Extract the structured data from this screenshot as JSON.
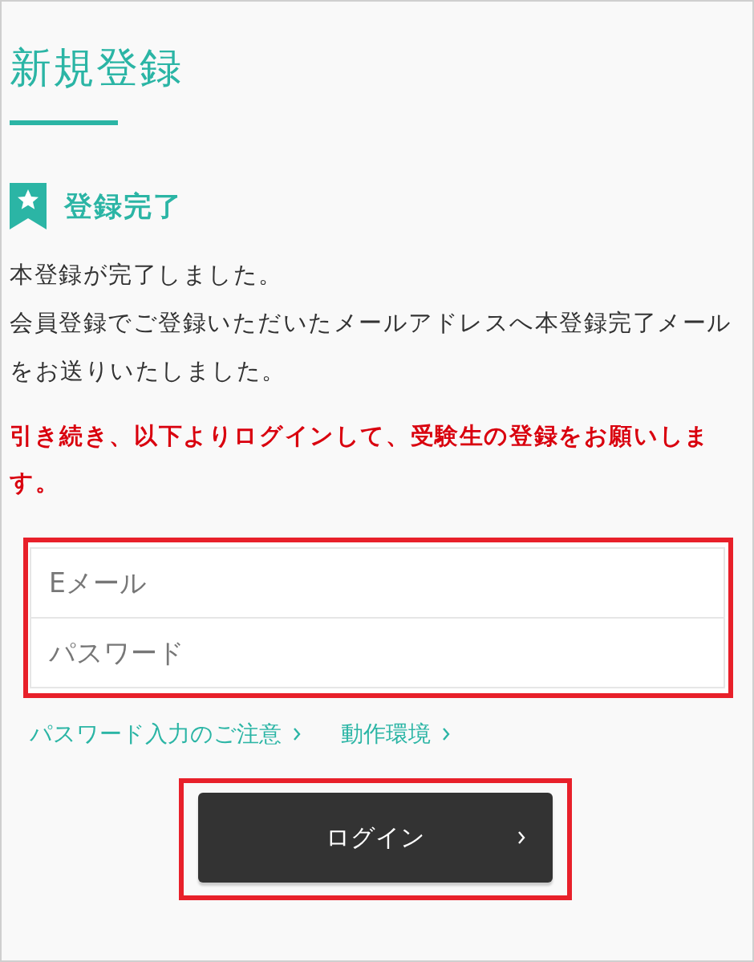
{
  "title": "新規登録",
  "section_heading": "登録完了",
  "paragraphs": [
    "本登録が完了しました。",
    "会員登録でご登録いただいたメールアドレスへ本登録完了メールをお送りいたしました。"
  ],
  "notice": "引き続き、以下よりログインして、受験生の登録をお願いします。",
  "fields": [
    {
      "placeholder": "Eメール"
    },
    {
      "placeholder": "パスワード"
    }
  ],
  "links": [
    {
      "label": "パスワード入力のご注意"
    },
    {
      "label": "動作環境"
    }
  ],
  "login_button": {
    "label": "ログイン"
  }
}
